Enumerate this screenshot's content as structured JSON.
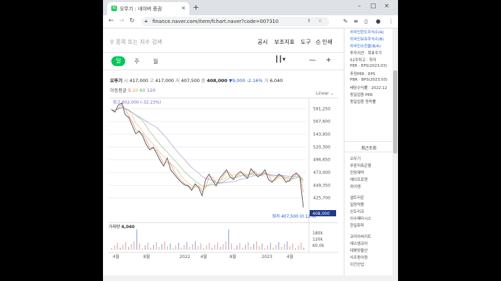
{
  "browser": {
    "tab_title": "오뚜기 : 네이버 증권",
    "tab_close": "×",
    "new_tab": "+",
    "url": "finance.naver.com/item/fchart.naver?code=007310",
    "win_min": "–",
    "win_max": "□",
    "win_close": "×"
  },
  "topbar": {
    "search_placeholder": "종목 또는 지수 검색",
    "menu": [
      "공시",
      "보조지표",
      "도구",
      "인쇄"
    ]
  },
  "periods": [
    "일",
    "주",
    "월"
  ],
  "quote": {
    "name": "오뚜기",
    "open_label": "시",
    "open": "417,000",
    "high_label": "고",
    "high": "417,000",
    "low_label": "저",
    "low": "407,500",
    "close_label": "종",
    "close": "408,000",
    "change": "▼9,000",
    "change_pct": "-2.16%",
    "prev_label": "거",
    "prev": "6,040"
  },
  "moving_avg": {
    "label": "이동평균",
    "periods": [
      "5",
      "20",
      "60",
      "120"
    ],
    "colors": [
      "#e6554d",
      "#f0a030",
      "#4caf50",
      "#7b68c8"
    ]
  },
  "scale_mode": "Linear",
  "chart_data": {
    "type": "line",
    "title": "",
    "y_ticks": [
      "591,250",
      "567,600",
      "543,950",
      "520,300",
      "496,650",
      "473,000",
      "449,350",
      "425,700"
    ],
    "ylim": [
      402050,
      606000
    ],
    "x_ticks": [
      "4월",
      "8월",
      "2022",
      "4월",
      "8월",
      "2023",
      "4월"
    ],
    "current_price_label": "408,000",
    "high_annotation": "최고 602,000 (-32.23%)",
    "low_annotation": "최저 407,500 (0.12%)",
    "series": [
      {
        "values": [
          590000,
          585000,
          598000,
          602000,
          580000,
          575000,
          560000,
          545000,
          550000,
          540000,
          525000,
          515000,
          520000,
          508000,
          495000,
          485000,
          500000,
          478000,
          470000,
          462000,
          455000,
          450000,
          448000,
          440000,
          452000,
          445000,
          430000,
          460000,
          470000,
          458000,
          448000,
          462000,
          470000,
          478000,
          465000,
          460000,
          470000,
          475000,
          468000,
          462000,
          480000,
          472000,
          465000,
          470000,
          478000,
          460000,
          455000,
          462000,
          470000,
          465000,
          455000,
          458000,
          468000,
          472000,
          464000,
          408000
        ],
        "color": "#333333"
      }
    ],
    "volume": {
      "label": "거래량",
      "value": "6,040",
      "ticks": [
        "180k",
        "120k",
        "60.0k"
      ]
    }
  },
  "sidebar": {
    "top_items": [
      "외국인한도주식수(A)",
      "외국인보유주식수(B)",
      "외국인소진율(B/A)",
      "투자의견 · 목표주가",
      "52주최고 · 최저",
      "PER · EPS(2023.03)",
      "추정PER · EPS",
      "PBR · BPS(2023.03)",
      "배당수익률 · 2022.12",
      "동일업종 PER",
      "동일업종 등락률"
    ],
    "recent_header": "최근조회",
    "recent_items": [
      "오뚜기",
      "푸른저축은행",
      "진양제약",
      "에이프로젠",
      "와이엠",
      "셀트리온",
      "일양약품",
      "신도리코",
      "이수페타시스",
      "한일화학",
      "코리아써키트",
      "에스엠코어",
      "태평양물산",
      "사조동아원",
      "이건산업"
    ]
  }
}
